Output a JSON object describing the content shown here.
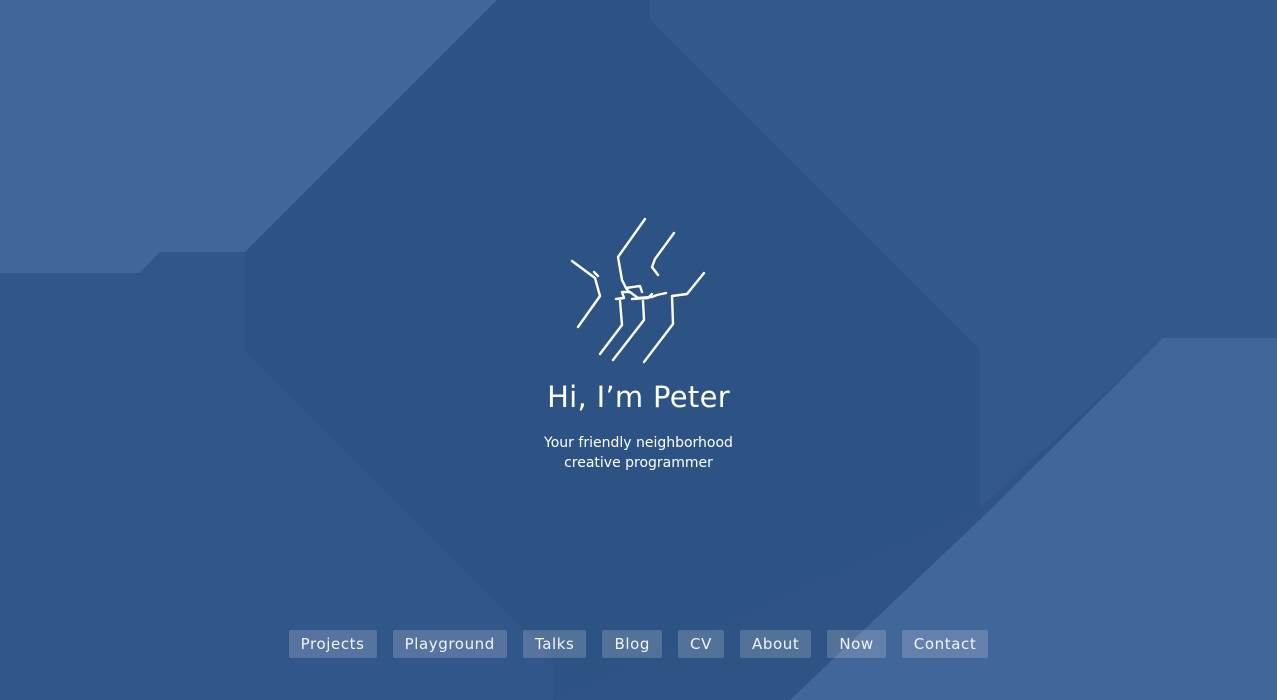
{
  "colors": {
    "background": "#2e5384",
    "panel_light": "#41669a",
    "panel_mid": "#33598c",
    "center": "#2d5384",
    "text": "#ffffff"
  },
  "hero": {
    "logo_icon": "hand-drawn-hands-logo",
    "title": "Hi, I’m Peter",
    "subtitle_line1": "Your friendly neighborhood",
    "subtitle_line2": "creative programmer"
  },
  "nav": {
    "items": [
      {
        "label": "Projects"
      },
      {
        "label": "Playground"
      },
      {
        "label": "Talks"
      },
      {
        "label": "Blog"
      },
      {
        "label": "CV"
      },
      {
        "label": "About"
      },
      {
        "label": "Now"
      },
      {
        "label": "Contact"
      }
    ]
  }
}
